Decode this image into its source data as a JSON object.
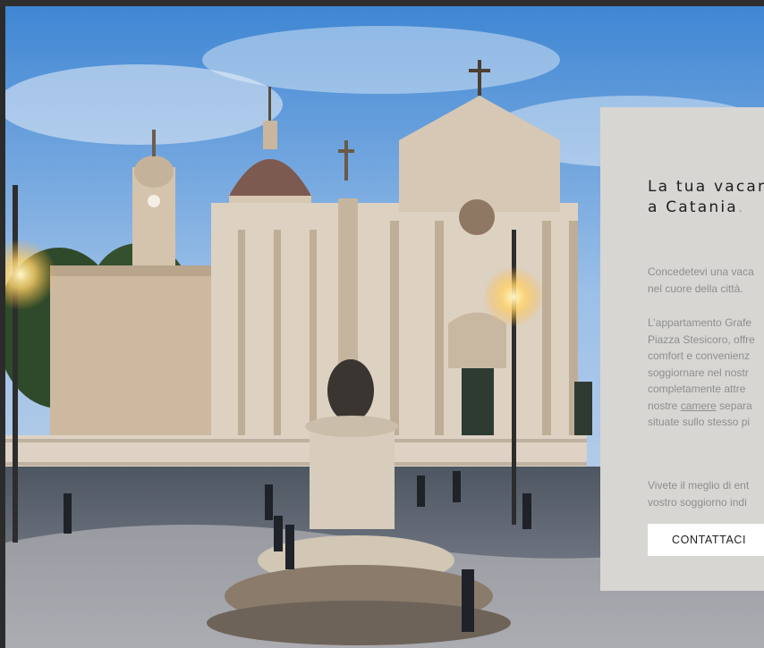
{
  "hero": {
    "image_description_icon": "cathedral-photo",
    "colors": {
      "sky": "#6fa6df",
      "stone": "#d9cbb6",
      "panel": "#d7d6d3"
    }
  },
  "panel": {
    "title_line1": "La tua vacanz",
    "title_line2": "a Catania",
    "title_period": ".",
    "para1": [
      "Concedetevi una vaca",
      "nel cuore della città."
    ],
    "para2": {
      "lines": [
        "L’appartamento Grafe",
        "Piazza Stesicoro, offre",
        "comfort e convenienz",
        "soggiornare nel nostr",
        "completamente attre"
      ],
      "line6_prefix": "nostre ",
      "line6_link": "camere",
      "line6_suffix": " separa",
      "line7": "situate sullo stesso pi"
    },
    "para3": [
      "Vivete il meglio di ent",
      "vostro soggiorno indi"
    ],
    "button_label": "CONTATTACI"
  }
}
